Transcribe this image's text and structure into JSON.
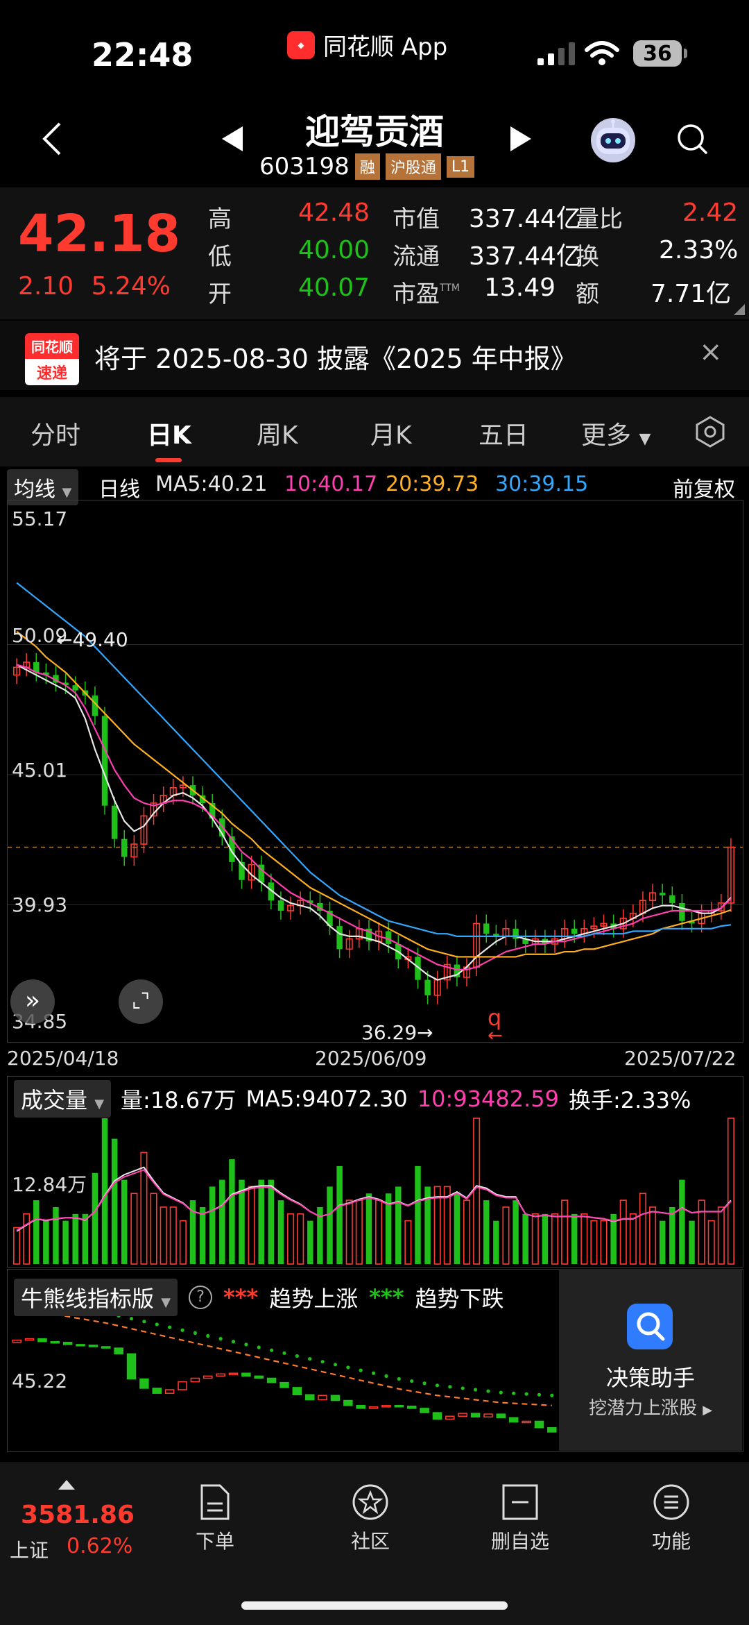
{
  "status": {
    "time": "22:48",
    "app_name": "同花顺 App",
    "battery": "36"
  },
  "nav": {
    "title": "迎驾贡酒",
    "code": "603198",
    "tags": [
      "融",
      "沪股通",
      "L1"
    ]
  },
  "quote": {
    "price": "42.18",
    "change": "2.10",
    "change_pct": "5.24%",
    "high_label": "高",
    "high": "42.48",
    "low_label": "低",
    "low": "40.00",
    "open_label": "开",
    "open": "40.07",
    "mcap_label": "市值",
    "mcap": "337.44亿",
    "float_label": "流通",
    "float": "337.44亿",
    "pe_label": "市盈",
    "pe_sup": "TTM",
    "pe": "13.49",
    "vr_label": "量比",
    "vr": "2.42",
    "turn_label": "换",
    "turn": "2.33%",
    "amt_label": "额",
    "amt": "7.71亿"
  },
  "notice": {
    "logo_top": "同花顺",
    "logo_bottom": "速递",
    "text": "将于 2025-08-30 披露《2025 年中报》",
    "close": "×"
  },
  "tabs": [
    "分时",
    "日K",
    "周K",
    "月K",
    "五日",
    "更多"
  ],
  "ma": {
    "mode": "均线",
    "period": "日线",
    "ma5": "MA5:40.21",
    "ma10": "10:40.17",
    "ma20": "20:39.73",
    "ma30": "30:39.15",
    "adjust": "前复权"
  },
  "colors": {
    "up": "#ff3b30",
    "down": "#1fc01a",
    "ma5": "#e8e8e8",
    "ma10": "#ff3fb0",
    "ma20": "#ffb020",
    "ma30": "#31a8ff"
  },
  "chart": {
    "y_labels": [
      "55.17",
      "50.09",
      "45.01",
      "39.93",
      "34.85"
    ],
    "high_mark": "49.40",
    "low_mark": "36.29→",
    "q_mark": "q",
    "dates": [
      "2025/04/18",
      "2025/06/09",
      "2025/07/22"
    ]
  },
  "volume": {
    "mode": "成交量",
    "vol": "量:18.67万",
    "ma5": "MA5:94072.30",
    "ma10": "10:93482.59",
    "turnover": "换手:2.33%",
    "y_label": "12.84万"
  },
  "bull": {
    "mode": "牛熊线指标版",
    "help": "?",
    "up_legend": "趋势上涨",
    "down_legend": "趋势下跌",
    "y_label": "45.22",
    "dots": "***"
  },
  "decision": {
    "title": "决策助手",
    "subtitle": "挖潜力上涨股"
  },
  "bottom": {
    "index_value": "3581.86",
    "index_name": "上证",
    "index_pct": "0.62%",
    "items": [
      "下单",
      "社区",
      "删自选",
      "功能"
    ]
  },
  "chart_data": {
    "type": "candlestick",
    "title": "",
    "xlabel": "",
    "ylabel": "",
    "ylim": [
      34.85,
      55.17
    ],
    "x_ticks": [
      "2025/04/18",
      "2025/06/09",
      "2025/07/22"
    ],
    "close": [
      49.2,
      49.4,
      49.0,
      48.9,
      48.6,
      48.5,
      48.3,
      48.1,
      47.3,
      43.8,
      42.5,
      41.8,
      42.3,
      43.4,
      43.9,
      44.2,
      44.5,
      44.6,
      44.2,
      43.9,
      43.3,
      42.6,
      41.6,
      40.9,
      41.5,
      40.8,
      40.1,
      39.7,
      39.9,
      40.1,
      40.0,
      39.7,
      39.1,
      38.2,
      38.6,
      39.0,
      38.5,
      38.9,
      38.4,
      37.8,
      37.9,
      37.0,
      36.4,
      37.0,
      37.6,
      37.1,
      37.5,
      39.2,
      38.8,
      38.7,
      39.0,
      38.6,
      38.4,
      38.6,
      38.4,
      38.6,
      39.0,
      38.8,
      39.0,
      39.1,
      39.2,
      39.0,
      39.4,
      39.6,
      40.1,
      40.4,
      40.3,
      40.0,
      39.3,
      39.2,
      39.6,
      39.7,
      40.0,
      42.18
    ],
    "series": [
      {
        "name": "MA5",
        "values": [
          49.3,
          49.1,
          48.9,
          48.7,
          48.5,
          48.3,
          48.0,
          47.2,
          46.0,
          45.0,
          44.0,
          43.2,
          42.8,
          43.0,
          43.5,
          43.9,
          44.2,
          44.3,
          44.1,
          43.8,
          43.3,
          42.7,
          42.0,
          41.5,
          41.1,
          40.8,
          40.5,
          40.2,
          40.0,
          39.9,
          39.8,
          39.5,
          39.1,
          38.8,
          38.7,
          38.7,
          38.6,
          38.5,
          38.3,
          38.1,
          37.8,
          37.5,
          37.2,
          37.0,
          37.1,
          37.2,
          37.5,
          37.9,
          38.2,
          38.5,
          38.7,
          38.7,
          38.6,
          38.5,
          38.5,
          38.5,
          38.6,
          38.7,
          38.8,
          38.9,
          39.0,
          39.1,
          39.2,
          39.4,
          39.6,
          39.8,
          39.9,
          39.9,
          39.8,
          39.7,
          39.6,
          39.6,
          39.8,
          40.21
        ]
      },
      {
        "name": "10",
        "values": [
          49.3,
          49.2,
          49.0,
          48.9,
          48.7,
          48.5,
          48.2,
          47.6,
          46.8,
          46.0,
          45.2,
          44.6,
          44.1,
          43.9,
          43.8,
          43.9,
          44.0,
          44.0,
          43.9,
          43.7,
          43.4,
          43.0,
          42.5,
          42.0,
          41.7,
          41.3,
          41.0,
          40.7,
          40.4,
          40.2,
          40.0,
          39.8,
          39.6,
          39.4,
          39.2,
          39.0,
          38.9,
          38.7,
          38.6,
          38.4,
          38.2,
          38.0,
          37.8,
          37.6,
          37.5,
          37.4,
          37.4,
          37.5,
          37.7,
          37.9,
          38.1,
          38.2,
          38.3,
          38.4,
          38.4,
          38.5,
          38.5,
          38.6,
          38.7,
          38.8,
          38.9,
          39.0,
          39.1,
          39.2,
          39.4,
          39.5,
          39.6,
          39.7,
          39.7,
          39.7,
          39.7,
          39.7,
          39.8,
          40.17
        ]
      },
      {
        "name": "20",
        "values": [
          50.6,
          50.3,
          50.0,
          49.6,
          49.3,
          49.0,
          48.6,
          48.2,
          47.8,
          47.4,
          47.0,
          46.6,
          46.2,
          45.9,
          45.6,
          45.3,
          45.0,
          44.7,
          44.4,
          44.1,
          43.8,
          43.5,
          43.1,
          42.8,
          42.5,
          42.1,
          41.8,
          41.5,
          41.2,
          40.9,
          40.6,
          40.4,
          40.2,
          40.0,
          39.8,
          39.6,
          39.4,
          39.2,
          39.0,
          38.8,
          38.6,
          38.4,
          38.2,
          38.1,
          38.0,
          37.9,
          37.9,
          37.9,
          37.9,
          37.9,
          37.9,
          37.9,
          38.0,
          38.0,
          38.0,
          38.0,
          38.1,
          38.1,
          38.2,
          38.2,
          38.3,
          38.4,
          38.5,
          38.6,
          38.7,
          38.8,
          39.0,
          39.1,
          39.2,
          39.3,
          39.4,
          39.5,
          39.6,
          39.73
        ]
      },
      {
        "name": "30",
        "values": [
          52.5,
          52.2,
          51.9,
          51.6,
          51.3,
          51.0,
          50.7,
          50.4,
          50.0,
          49.6,
          49.2,
          48.8,
          48.4,
          48.0,
          47.6,
          47.2,
          46.8,
          46.4,
          46.0,
          45.6,
          45.2,
          44.8,
          44.4,
          44.0,
          43.6,
          43.2,
          42.8,
          42.4,
          42.0,
          41.6,
          41.2,
          40.9,
          40.6,
          40.3,
          40.1,
          39.9,
          39.7,
          39.5,
          39.3,
          39.2,
          39.1,
          39.0,
          38.9,
          38.8,
          38.8,
          38.7,
          38.7,
          38.7,
          38.7,
          38.7,
          38.7,
          38.7,
          38.7,
          38.7,
          38.7,
          38.7,
          38.7,
          38.7,
          38.7,
          38.8,
          38.8,
          38.8,
          38.8,
          38.9,
          38.9,
          38.9,
          39.0,
          39.0,
          39.0,
          39.0,
          39.0,
          39.0,
          39.1,
          39.15
        ]
      }
    ]
  }
}
